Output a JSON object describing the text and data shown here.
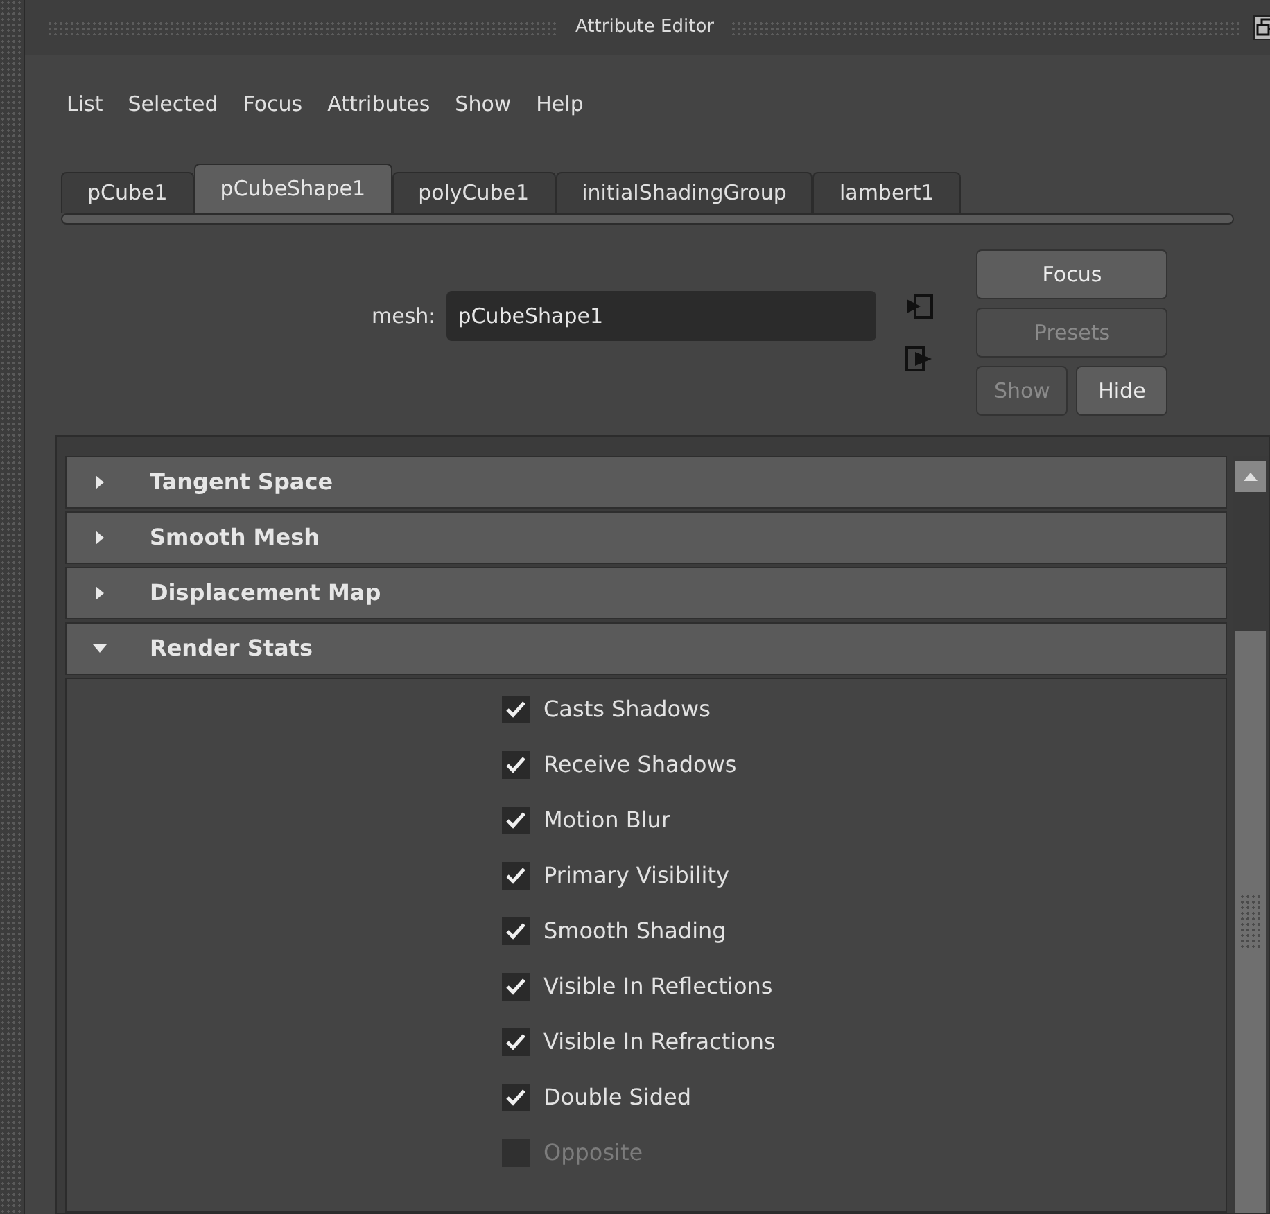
{
  "window": {
    "title": "Attribute Editor"
  },
  "menu": [
    "List",
    "Selected",
    "Focus",
    "Attributes",
    "Show",
    "Help"
  ],
  "tabs": [
    {
      "label": "pCube1",
      "selected": false
    },
    {
      "label": "pCubeShape1",
      "selected": true
    },
    {
      "label": "polyCube1",
      "selected": false
    },
    {
      "label": "initialShadingGroup",
      "selected": false
    },
    {
      "label": "lambert1",
      "selected": false
    }
  ],
  "node": {
    "label": "mesh:",
    "value": "pCubeShape1"
  },
  "buttons": [
    {
      "label": "Focus",
      "disabled": false
    },
    {
      "label": "Presets",
      "disabled": true
    }
  ],
  "visibility_buttons": [
    {
      "label": "Show",
      "disabled": true
    },
    {
      "label": "Hide",
      "disabled": false
    }
  ],
  "sections": [
    {
      "title": "Tangent Space",
      "expanded": false
    },
    {
      "title": "Smooth Mesh",
      "expanded": false
    },
    {
      "title": "Displacement Map",
      "expanded": false
    },
    {
      "title": "Render Stats",
      "expanded": true
    }
  ],
  "render_stats": [
    {
      "label": "Casts Shadows",
      "checked": true,
      "disabled": false
    },
    {
      "label": "Receive Shadows",
      "checked": true,
      "disabled": false
    },
    {
      "label": "Motion Blur",
      "checked": true,
      "disabled": false
    },
    {
      "label": "Primary Visibility",
      "checked": true,
      "disabled": false
    },
    {
      "label": "Smooth Shading",
      "checked": true,
      "disabled": false
    },
    {
      "label": "Visible In Reflections",
      "checked": true,
      "disabled": false
    },
    {
      "label": "Visible In Refractions",
      "checked": true,
      "disabled": false
    },
    {
      "label": "Double Sided",
      "checked": true,
      "disabled": false
    },
    {
      "label": "Opposite",
      "checked": false,
      "disabled": true
    }
  ]
}
